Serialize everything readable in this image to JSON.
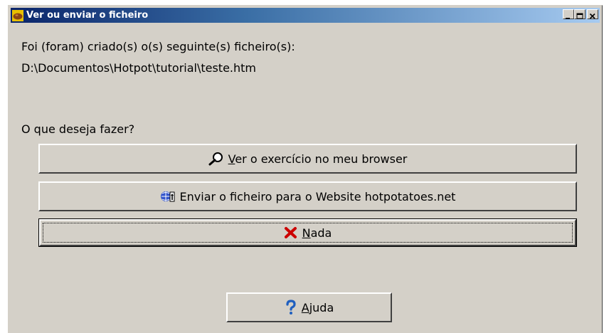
{
  "window": {
    "title": "Ver ou enviar o ficheiro",
    "buttons": {
      "minimize": "minimize",
      "maximize": "maximize",
      "close": "close"
    }
  },
  "message": {
    "line1": "Foi (foram) criado(s) o(s) seguinte(s) ficheiro(s):",
    "line2": "D:\\Documentos\\Hotpot\\tutorial\\teste.htm",
    "prompt": "O que deseja fazer?"
  },
  "actions": {
    "view": {
      "label": "Ver o exercício no meu browser",
      "icon": "magnifier-icon"
    },
    "upload": {
      "label": "Enviar o ficheiro para o Website hotpotatoes.net",
      "icon": "upload-web-icon"
    },
    "nothing": {
      "label": "Nada",
      "icon": "red-x-icon"
    },
    "help": {
      "label": "Ajuda",
      "icon": "question-icon"
    }
  },
  "colors": {
    "face": "#d4d0c8",
    "title_start": "#0a246a",
    "title_end": "#a6caf0",
    "cancel_red": "#cc0000",
    "help_blue": "#1f5fbf"
  }
}
